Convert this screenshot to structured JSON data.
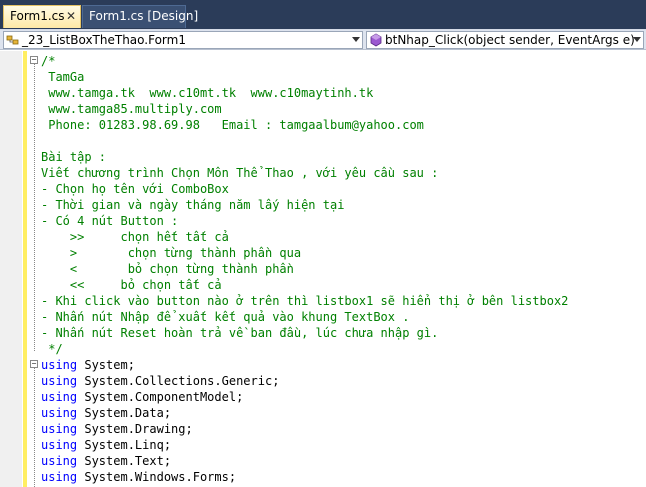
{
  "tabs": [
    {
      "label": "Form1.cs",
      "active": true
    },
    {
      "label": "Form1.cs [Design]",
      "active": false
    }
  ],
  "navbar": {
    "type_combo": "_23_ListBoxTheThao.Form1",
    "member_combo": "btNhap_Click(object sender, EventArgs e)"
  },
  "comment_lines": [
    "/*",
    " TamGa",
    " www.tamga.tk  www.c10mt.tk  www.c10maytinh.tk",
    " www.tamga85.multiply.com",
    " Phone: 01283.98.69.98   Email : tamgaalbum@yahoo.com",
    "",
    "Bài tập :",
    "Viết chương trình Chọn Môn Thể Thao , với yêu cầu sau :",
    "- Chọn họ tên với ComboBox",
    "- Thời gian và ngày tháng năm lấy hiện tại",
    "- Có 4 nút Button :",
    "    >>     chọn hết tất cả",
    "    >       chọn từng thành phần qua",
    "    <       bỏ chọn từng thành phần",
    "    <<     bỏ chọn tất cả",
    "- Khi click vào button nào ở trên thì listbox1 sẽ hiển thị ở bên listbox2",
    "- Nhấn nút Nhập để xuất kết quả vào khung TextBox .",
    "- Nhấn nút Reset hoàn trả về ban đầu, lúc chưa nhập gì.",
    " */"
  ],
  "using_keyword": "using",
  "using_lines": [
    "System;",
    "System.Collections.Generic;",
    "System.ComponentModel;",
    "System.Data;",
    "System.Drawing;",
    "System.Linq;",
    "System.Text;",
    "System.Windows.Forms;"
  ],
  "colors": {
    "comment": "#008000",
    "keyword": "#0000ff",
    "tab_strip": "#2b3c59",
    "active_tab": "#ffe9a6"
  }
}
